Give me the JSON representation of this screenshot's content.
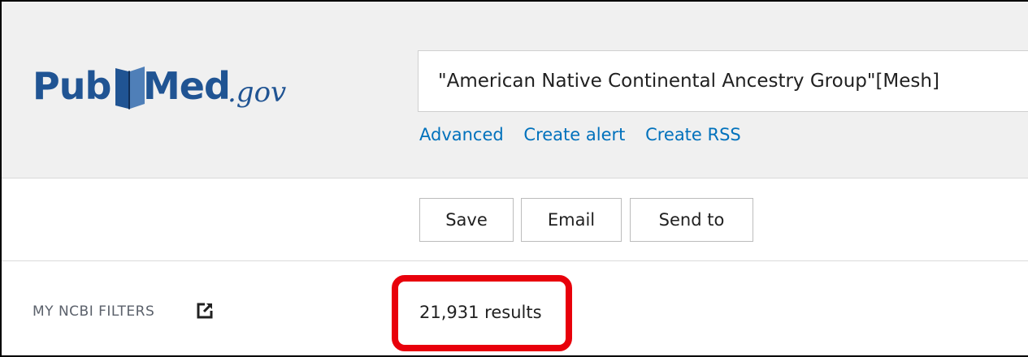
{
  "logo": {
    "pub": "Pub",
    "med": "Med",
    "gov": ".gov"
  },
  "search": {
    "query": "\"American Native Continental Ancestry Group\"[Mesh]",
    "links": [
      "Advanced",
      "Create alert",
      "Create RSS"
    ]
  },
  "actions": {
    "save_label": "Save",
    "email_label": "Email",
    "send_to_label": "Send to"
  },
  "filters": {
    "label": "MY NCBI FILTERS",
    "icon": "external-link-icon"
  },
  "results": {
    "count_text": "21,931 results"
  },
  "colors": {
    "brand_blue": "#205493",
    "link_blue": "#0071bc",
    "header_bg": "#f0f0f0",
    "highlight_red": "#e8000b"
  }
}
